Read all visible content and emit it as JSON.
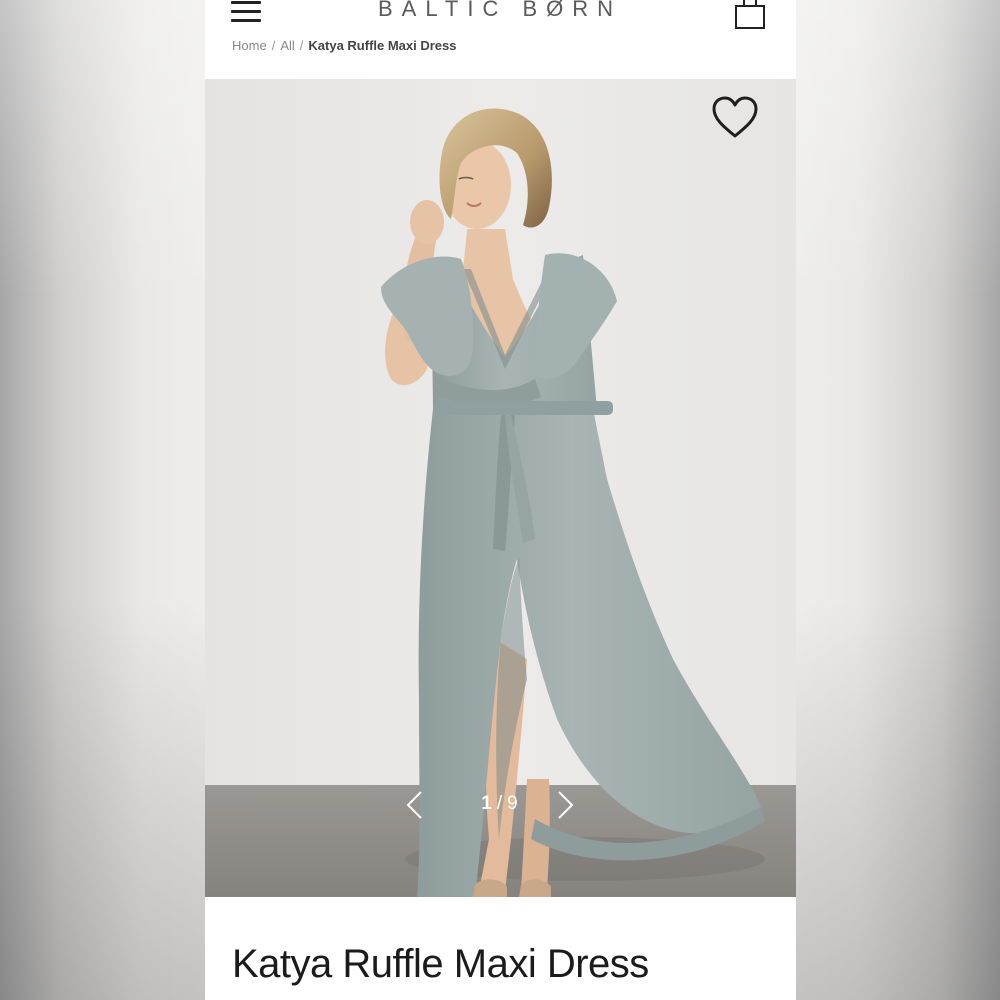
{
  "header": {
    "menu_icon": "hamburger-menu-icon",
    "brand": "BALTIC BØRN",
    "bag_icon": "shopping-bag-icon"
  },
  "breadcrumb": [
    {
      "label": "Home"
    },
    {
      "label": "All"
    },
    {
      "label": "Katya Ruffle Maxi Dress",
      "current": true
    }
  ],
  "gallery": {
    "wishlist_icon": "heart-outline-icon",
    "prev_icon": "chevron-left-icon",
    "next_icon": "chevron-right-icon",
    "current_image": "1",
    "total_images": "9",
    "separator": "/"
  },
  "product": {
    "title": "Katya Ruffle Maxi Dress"
  },
  "colors": {
    "dress": "#a3b0b0",
    "wall": "#e8e7e5",
    "floor": "#8d8b87",
    "text_dark": "#1b1b1b",
    "logo": "#5a5a5a"
  }
}
